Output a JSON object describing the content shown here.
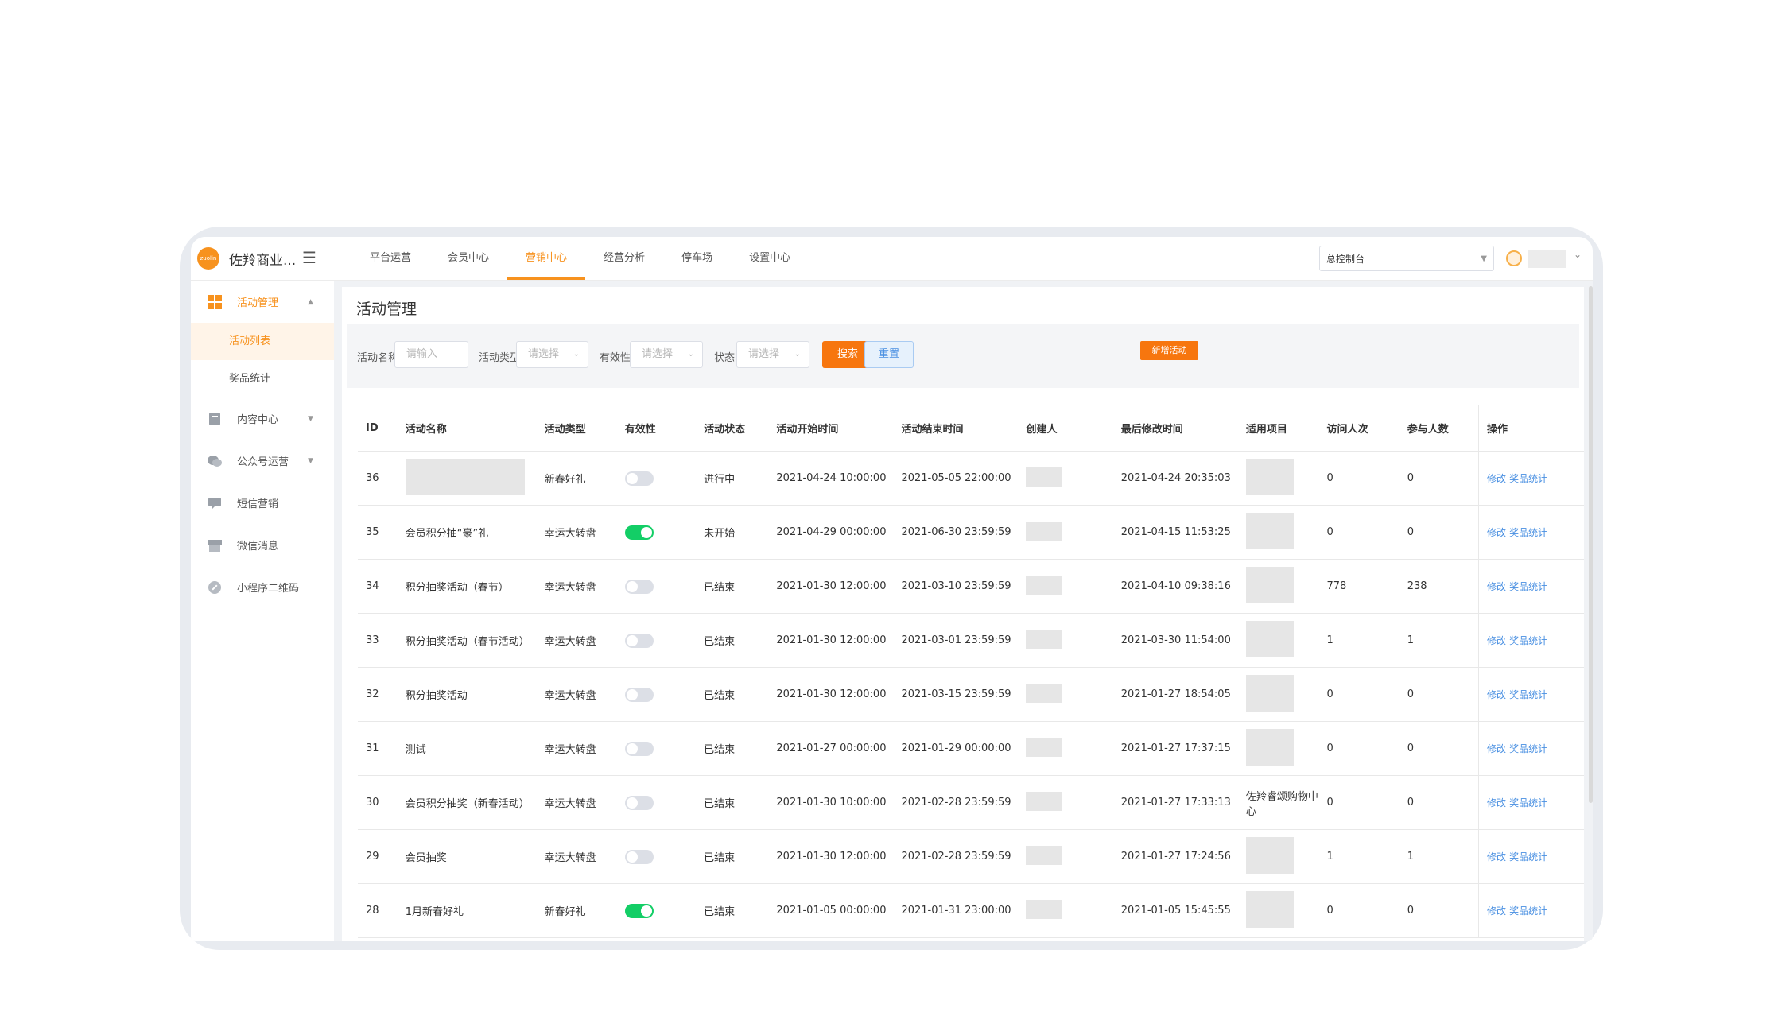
{
  "header": {
    "logo_text": "zuolin",
    "brand": "佐羚商业...",
    "nav": [
      {
        "label": "平台运营"
      },
      {
        "label": "会员中心"
      },
      {
        "label": "营销中心",
        "active": true
      },
      {
        "label": "经营分析"
      },
      {
        "label": "停车场"
      },
      {
        "label": "设置中心"
      }
    ],
    "console_select": "总控制台"
  },
  "sidebar": {
    "groups": [
      {
        "label": "活动管理",
        "icon": "grid-icon",
        "expanded": true,
        "children": [
          {
            "label": "活动列表",
            "active": true
          },
          {
            "label": "奖品统计"
          }
        ]
      },
      {
        "label": "内容中心",
        "icon": "document-icon"
      },
      {
        "label": "公众号运营",
        "icon": "wechat-icon"
      },
      {
        "label": "短信营销",
        "icon": "message-icon"
      },
      {
        "label": "微信消息",
        "icon": "store-icon"
      },
      {
        "label": "小程序二维码",
        "icon": "link-icon"
      }
    ]
  },
  "page": {
    "title": "活动管理",
    "filters": {
      "name_label": "活动名称:",
      "name_placeholder": "请输入",
      "type_label": "活动类型:",
      "type_placeholder": "请选择",
      "valid_label": "有效性:",
      "valid_placeholder": "请选择",
      "status_label": "状态:",
      "status_placeholder": "请选择",
      "search_button": "搜索",
      "reset_button": "重置",
      "new_button": "新增活动"
    }
  },
  "table": {
    "headers": [
      "ID",
      "活动名称",
      "活动类型",
      "有效性",
      "活动状态",
      "活动开始时间",
      "活动结束时间",
      "创建人",
      "最后修改时间",
      "适用项目",
      "访问人次",
      "参与人数",
      "操作"
    ],
    "action_edit": "修改",
    "action_stats": "奖品统计",
    "rows": [
      {
        "id": "36",
        "name": "",
        "type": "新春好礼",
        "valid": false,
        "status": "进行中",
        "start": "2021-04-24 10:00:00",
        "end": "2021-05-05 22:00:00",
        "modified": "2021-04-24 20:35:03",
        "project": "",
        "visits": "0",
        "participants": "0"
      },
      {
        "id": "35",
        "name": "会员积分抽“豪”礼",
        "type": "幸运大转盘",
        "valid": true,
        "status": "未开始",
        "start": "2021-04-29 00:00:00",
        "end": "2021-06-30 23:59:59",
        "modified": "2021-04-15 11:53:25",
        "project": "",
        "visits": "0",
        "participants": "0"
      },
      {
        "id": "34",
        "name": "积分抽奖活动（春节）",
        "type": "幸运大转盘",
        "valid": false,
        "status": "已结束",
        "start": "2021-01-30 12:00:00",
        "end": "2021-03-10 23:59:59",
        "modified": "2021-04-10 09:38:16",
        "project": "",
        "visits": "778",
        "participants": "238"
      },
      {
        "id": "33",
        "name": "积分抽奖活动（春节活动）",
        "type": "幸运大转盘",
        "valid": false,
        "status": "已结束",
        "start": "2021-01-30 12:00:00",
        "end": "2021-03-01 23:59:59",
        "modified": "2021-03-30 11:54:00",
        "project": "",
        "visits": "1",
        "participants": "1"
      },
      {
        "id": "32",
        "name": "积分抽奖活动",
        "type": "幸运大转盘",
        "valid": false,
        "status": "已结束",
        "start": "2021-01-30 12:00:00",
        "end": "2021-03-15 23:59:59",
        "modified": "2021-01-27 18:54:05",
        "project": "",
        "visits": "0",
        "participants": "0"
      },
      {
        "id": "31",
        "name": "测试",
        "type": "幸运大转盘",
        "valid": false,
        "status": "已结束",
        "start": "2021-01-27 00:00:00",
        "end": "2021-01-29 00:00:00",
        "modified": "2021-01-27 17:37:15",
        "project": "",
        "visits": "0",
        "participants": "0"
      },
      {
        "id": "30",
        "name": "会员积分抽奖（新春活动）",
        "type": "幸运大转盘",
        "valid": false,
        "status": "已结束",
        "start": "2021-01-30 10:00:00",
        "end": "2021-02-28 23:59:59",
        "modified": "2021-01-27 17:33:13",
        "project": "佐羚睿颂购物中心",
        "visits": "0",
        "participants": "0"
      },
      {
        "id": "29",
        "name": "会员抽奖",
        "type": "幸运大转盘",
        "valid": false,
        "status": "已结束",
        "start": "2021-01-30 12:00:00",
        "end": "2021-02-28 23:59:59",
        "modified": "2021-01-27 17:24:56",
        "project": "",
        "visits": "1",
        "participants": "1"
      },
      {
        "id": "28",
        "name": "1月新春好礼",
        "type": "新春好礼",
        "valid": true,
        "status": "已结束",
        "start": "2021-01-05 00:00:00",
        "end": "2021-01-31 23:00:00",
        "modified": "2021-01-05 15:45:55",
        "project": "",
        "visits": "0",
        "participants": "0"
      }
    ]
  },
  "colors": {
    "accent": "#f7921e",
    "primary_button": "#f7760e",
    "link": "#4a90e2",
    "toggle_on": "#13ce66"
  }
}
